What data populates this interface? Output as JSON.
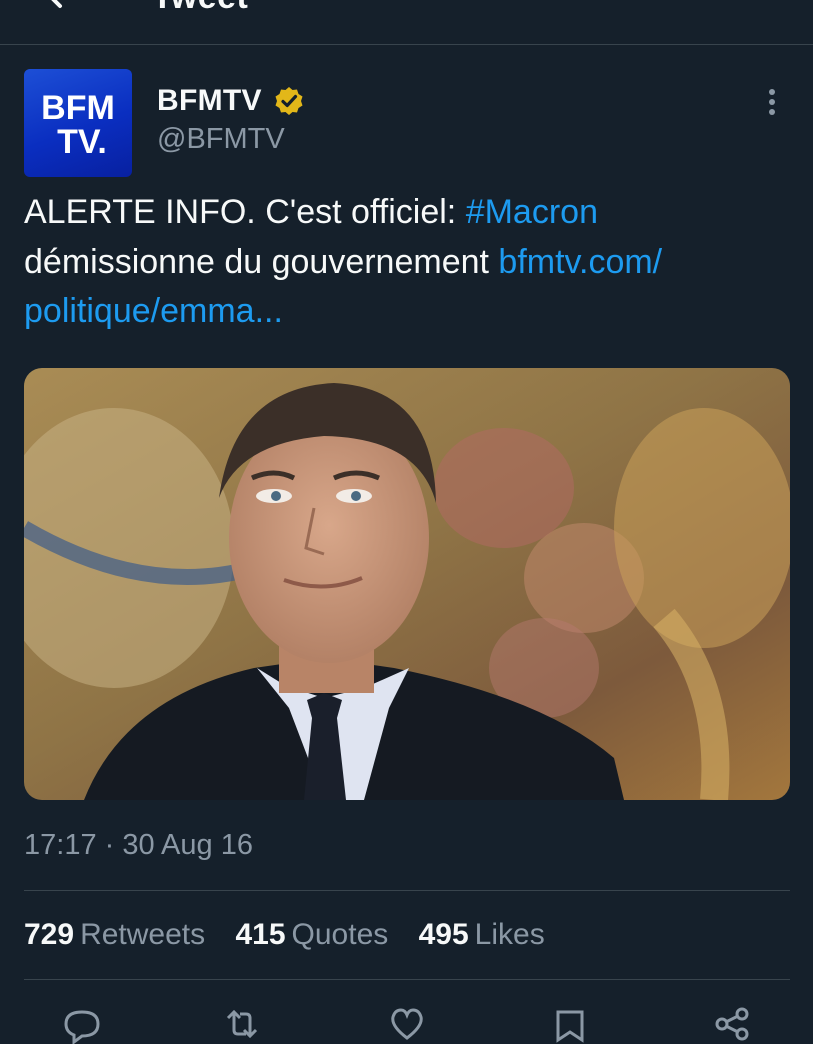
{
  "header": {
    "title": "Tweet",
    "back_icon": "arrow-left-icon"
  },
  "tweet": {
    "author_name": "BFMTV",
    "author_handle": "@BFMTV",
    "verified_icon": "verified-badge-gold-icon",
    "avatar_text_line1": "BFM",
    "avatar_text_line2": "TV.",
    "text_part1": "ALERTE INFO. C'est officiel: ",
    "hashtag": "#Macron",
    "text_part2": " démissionne du gouvernement ",
    "link_part1": "bfmtv.com/",
    "link_part2": "politique/emma...",
    "timestamp": "17:17 · 30 Aug 16",
    "colors": {
      "link": "#1d9bf0",
      "background": "#15202b",
      "secondary_text": "#8b98a5",
      "verified": "#e2b719",
      "avatar_bg": "#1037d0"
    }
  },
  "stats": {
    "retweets_count": "729",
    "retweets_label": "Retweets",
    "quotes_count": "415",
    "quotes_label": "Quotes",
    "likes_count": "495",
    "likes_label": "Likes"
  },
  "actions": [
    "reply-icon",
    "retweet-icon",
    "like-icon",
    "bookmark-icon",
    "share-icon"
  ]
}
